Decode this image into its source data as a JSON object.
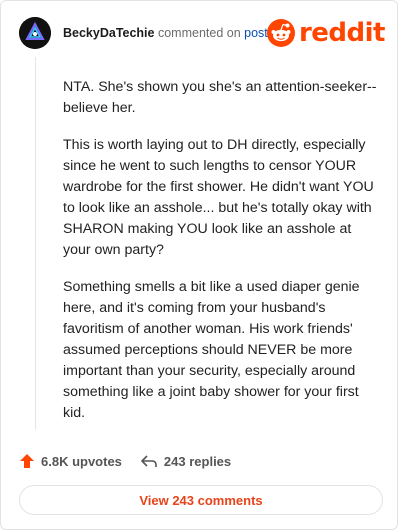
{
  "header": {
    "username": "BeckyDaTechie",
    "action_text": "commented on",
    "post_link": "post",
    "brand": "reddit",
    "colors": {
      "brand": "#ff4500",
      "link": "#0a4fb0"
    }
  },
  "comment": {
    "paragraphs": [
      "NTA. She's shown you she's an attention-seeker-- believe her.",
      "This is worth laying out to DH directly, especially since he went to such lengths to censor YOUR wardrobe for the first shower. He didn't want YOU to look like an asshole... but he's totally okay with SHARON making YOU look like an asshole at your own party?",
      "Something smells a bit like a used diaper genie here, and it's coming from your husband's favoritism of another woman. His work friends' assumed perceptions should NEVER be more important than your security, especially around something like a joint baby shower for your first kid."
    ]
  },
  "footer": {
    "upvotes": "6.8K upvotes",
    "replies": "243 replies",
    "view_comments": "View 243 comments",
    "icons": {
      "upvote": "upvote-arrow-icon",
      "reply": "reply-arrow-icon"
    }
  }
}
